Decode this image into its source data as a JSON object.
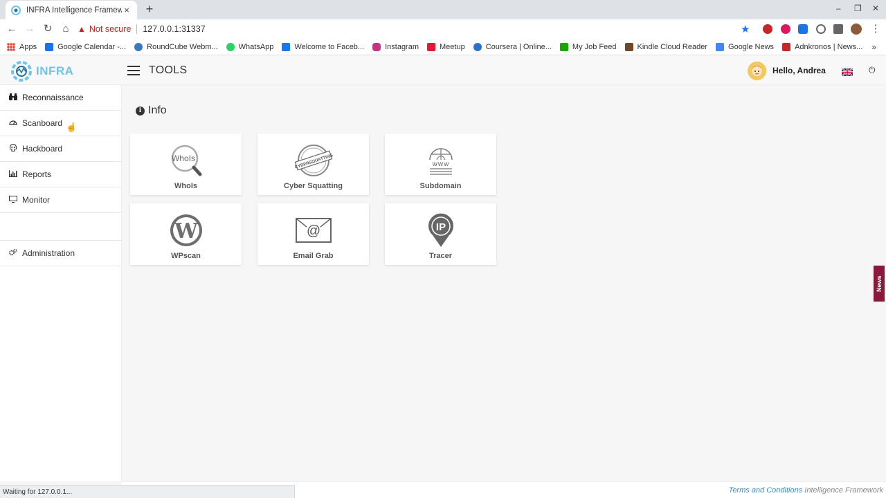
{
  "browser": {
    "tab_title": "INFRA Intelligence Framework",
    "new_tab": "+",
    "close_tab": "×",
    "security_label": "Not secure",
    "url": "127.0.0.1:31337",
    "bookmarks": [
      {
        "label": "Apps",
        "color": "#4285f4"
      },
      {
        "label": "Google Calendar -...",
        "color": "#1a73e8"
      },
      {
        "label": "RoundCube Webm...",
        "color": "#3b78c2"
      },
      {
        "label": "WhatsApp",
        "color": "#25d366"
      },
      {
        "label": "Welcome to Faceb...",
        "color": "#1877f2"
      },
      {
        "label": "Instagram",
        "color": "#c13584"
      },
      {
        "label": "Meetup",
        "color": "#e51937"
      },
      {
        "label": "Coursera | Online...",
        "color": "#2a73cc"
      },
      {
        "label": "My Job Feed",
        "color": "#14a800"
      },
      {
        "label": "Kindle Cloud Reader",
        "color": "#6b4a2b"
      },
      {
        "label": "Google News",
        "color": "#4285f4"
      },
      {
        "label": "Adnkronos | News...",
        "color": "#c62828"
      }
    ],
    "status_text": "Waiting for 127.0.0.1..."
  },
  "header": {
    "logo_text": "INFRA",
    "title": "TOOLS",
    "greeting": "Hello, Andrea"
  },
  "sidebar": {
    "items": [
      {
        "label": "Reconnaissance",
        "icon": "binoculars-icon"
      },
      {
        "label": "Scanboard",
        "icon": "dashboard-icon"
      },
      {
        "label": "Hackboard",
        "icon": "skull-icon"
      },
      {
        "label": "Reports",
        "icon": "bar-chart-icon"
      },
      {
        "label": "Monitor",
        "icon": "monitor-icon"
      },
      {
        "label": "Administration",
        "icon": "cogs-icon"
      }
    ]
  },
  "main": {
    "section_title": "Info",
    "tools": [
      {
        "label": "WhoIs",
        "icon_text": "WhoIs"
      },
      {
        "label": "Cyber Squatting",
        "icon_text": "CYBERSQUATTING"
      },
      {
        "label": "Subdomain",
        "icon_text": "www"
      },
      {
        "label": "WPscan",
        "icon_text": "W"
      },
      {
        "label": "Email Grab",
        "icon_text": "@"
      },
      {
        "label": "Tracer",
        "icon_text": "IP"
      }
    ]
  },
  "news_tab": "News",
  "footer": {
    "terms_link": "Terms and Conditions",
    "brand": "Intelligence Framework"
  },
  "colors": {
    "logo": "#6fc4e8",
    "news_tab": "#8b1a3a",
    "link": "#3a8fc1",
    "warning": "#c5221f"
  }
}
